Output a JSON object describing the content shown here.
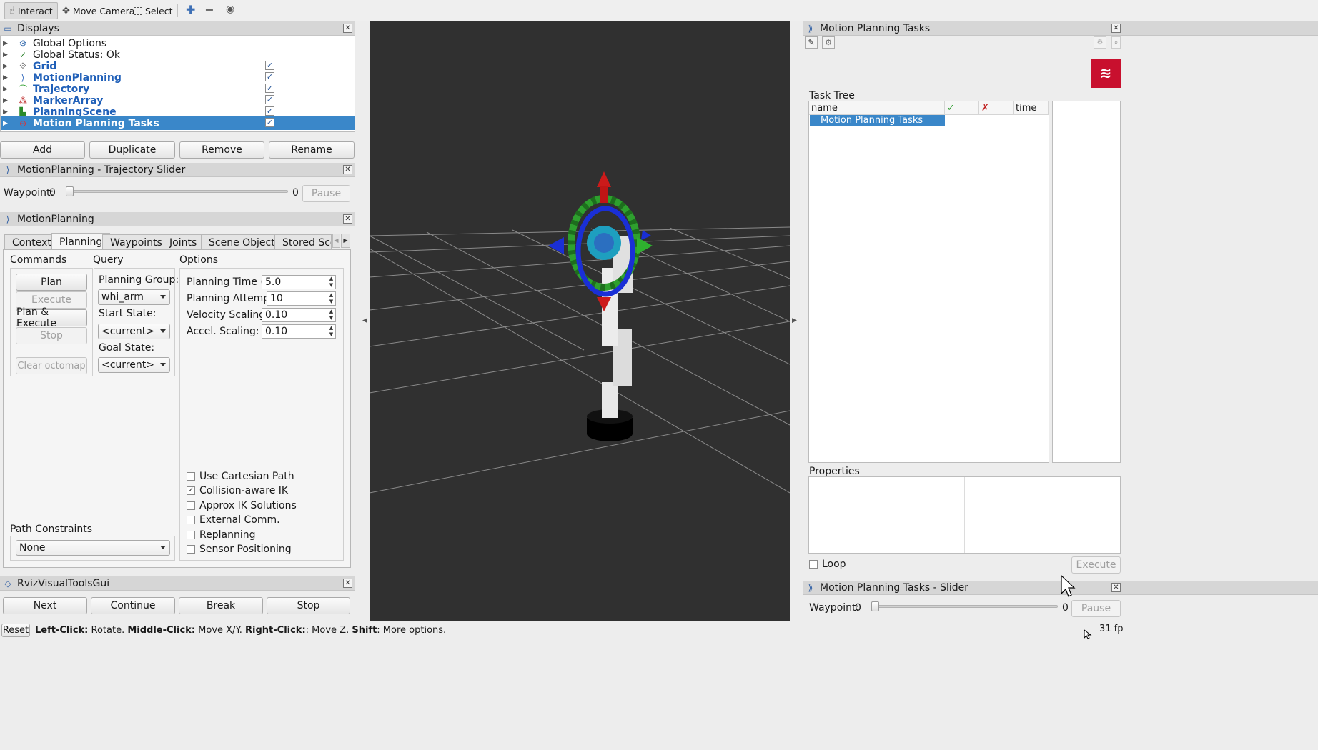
{
  "toolbar": {
    "interact": "Interact",
    "move_camera": "Move Camera",
    "select": "Select"
  },
  "displays": {
    "title": "Displays",
    "items": [
      {
        "label": "Global Options",
        "icon": "gear-icon",
        "checked": null
      },
      {
        "label": "Global Status: Ok",
        "icon": "check-icon",
        "checked": null
      },
      {
        "label": "Grid",
        "icon": "grid-icon",
        "checked": true
      },
      {
        "label": "MotionPlanning",
        "icon": "motion-planning-icon",
        "checked": true
      },
      {
        "label": "Trajectory",
        "icon": "trajectory-icon",
        "checked": true
      },
      {
        "label": "MarkerArray",
        "icon": "marker-array-icon",
        "checked": true
      },
      {
        "label": "PlanningScene",
        "icon": "planning-scene-icon",
        "checked": true
      },
      {
        "label": "Motion Planning Tasks",
        "icon": "stop-icon",
        "checked": true,
        "selected": true
      }
    ],
    "buttons": {
      "add": "Add",
      "duplicate": "Duplicate",
      "remove": "Remove",
      "rename": "Rename"
    }
  },
  "trajectory_slider": {
    "title": "MotionPlanning - Trajectory Slider",
    "waypoint_label": "Waypoint:",
    "waypoint_value": "0",
    "max_value": "0",
    "pause": "Pause",
    "position": 0
  },
  "motion_planning": {
    "title": "MotionPlanning",
    "tabs": [
      "Context",
      "Planning",
      "Waypoints",
      "Joints",
      "Scene Objects",
      "Stored Scen"
    ],
    "active_tab": "Planning",
    "commands": {
      "title": "Commands",
      "plan": "Plan",
      "execute": "Execute",
      "plan_execute": "Plan & Execute",
      "stop": "Stop",
      "clear_octomap": "Clear octomap"
    },
    "query": {
      "title": "Query",
      "planning_group_label": "Planning Group:",
      "planning_group": "whi_arm",
      "start_state_label": "Start State:",
      "start_state": "<current>",
      "goal_state_label": "Goal State:",
      "goal_state": "<current>"
    },
    "options": {
      "title": "Options",
      "planning_time_label": "Planning Time (s):",
      "planning_time": "5.0",
      "planning_attempts_label": "Planning Attempts:",
      "planning_attempts": "10",
      "velocity_scaling_label": "Velocity Scaling:",
      "velocity_scaling": "0.10",
      "accel_scaling_label": "Accel. Scaling:",
      "accel_scaling": "0.10",
      "checkboxes": [
        {
          "label": "Use Cartesian Path",
          "checked": false
        },
        {
          "label": "Collision-aware IK",
          "checked": true
        },
        {
          "label": "Approx IK Solutions",
          "checked": false
        },
        {
          "label": "External Comm.",
          "checked": false
        },
        {
          "label": "Replanning",
          "checked": false
        },
        {
          "label": "Sensor Positioning",
          "checked": false
        }
      ]
    },
    "path_constraints_label": "Path Constraints",
    "path_constraints": "None"
  },
  "rviz_visual_tools": {
    "title": "RvizVisualToolsGui",
    "next": "Next",
    "continue": "Continue",
    "break": "Break",
    "stop": "Stop"
  },
  "mpt_panel": {
    "title": "Motion Planning Tasks",
    "task_tree_label": "Task Tree",
    "columns": {
      "name": "name",
      "success": "✓",
      "fail": "✗",
      "time": "time"
    },
    "rows": [
      "Motion Planning Tasks"
    ],
    "properties_label": "Properties",
    "loop": "Loop",
    "execute": "Execute"
  },
  "mpt_slider": {
    "title": "Motion Planning Tasks - Slider",
    "waypoint_label": "Waypoint:",
    "waypoint_value": "0",
    "max_value": "0",
    "pause": "Pause"
  },
  "statusbar": {
    "reset": "Reset",
    "left_click": "Left-Click:",
    "left_click_desc": " Rotate. ",
    "middle_click": "Middle-Click:",
    "middle_click_desc": " Move X/Y. ",
    "right_click": "Right-Click:",
    "right_click_desc": ": Move Z. ",
    "shift": "Shift",
    "shift_desc": ": More options.",
    "fps": "31 fp"
  },
  "colors": {
    "accent": "#3a87c9",
    "viewport_bg": "#303030",
    "link_blue": "#1f5fb8"
  }
}
